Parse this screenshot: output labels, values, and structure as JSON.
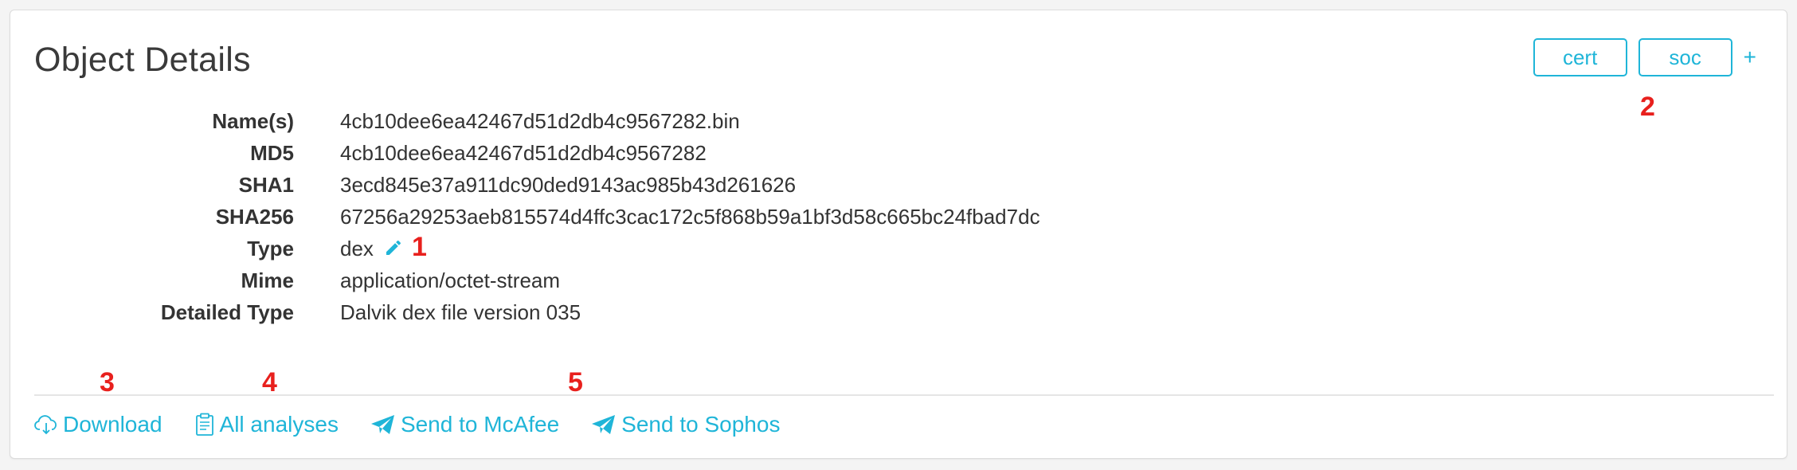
{
  "card": {
    "title": "Object Details"
  },
  "tags": {
    "items": [
      "cert",
      "soc"
    ],
    "add_label": "+"
  },
  "details": [
    {
      "label": "Name(s)",
      "value": "4cb10dee6ea42467d51d2db4c9567282.bin"
    },
    {
      "label": "MD5",
      "value": "4cb10dee6ea42467d51d2db4c9567282"
    },
    {
      "label": "SHA1",
      "value": "3ecd845e37a911dc90ded9143ac985b43d261626"
    },
    {
      "label": "SHA256",
      "value": "67256a29253aeb815574d4ffc3cac172c5f868b59a1bf3d58c665bc24fbad7dc"
    },
    {
      "label": "Type",
      "value": "dex"
    },
    {
      "label": "Mime",
      "value": "application/octet-stream"
    },
    {
      "label": "Detailed Type",
      "value": "Dalvik dex file version 035"
    }
  ],
  "actions": {
    "download": "Download",
    "all_analyses": "All analyses",
    "send_mcafee": "Send to McAfee",
    "send_sophos": "Send to Sophos"
  },
  "annotations": {
    "a1": "1",
    "a2": "2",
    "a3": "3",
    "a4": "4",
    "a5": "5"
  },
  "colors": {
    "accent": "#1fb5d8",
    "annotation": "#e8201d"
  }
}
